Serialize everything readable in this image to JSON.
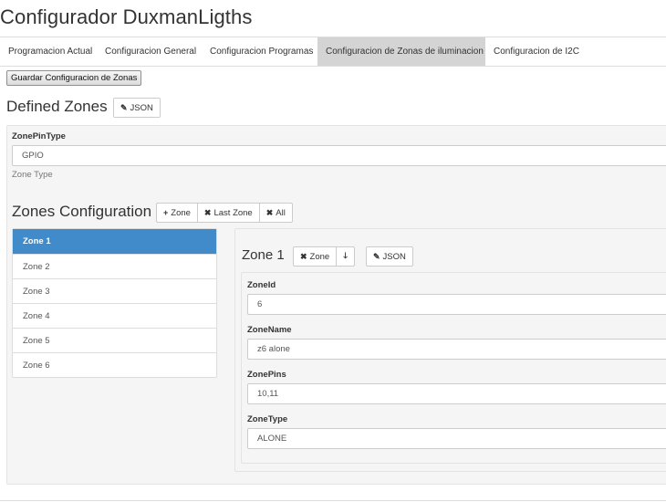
{
  "app": {
    "title": "Configurador DuxmanLigths"
  },
  "tabs": [
    {
      "label": "Programacion Actual",
      "active": false
    },
    {
      "label": "Configuracion General",
      "active": false
    },
    {
      "label": "Configuracion Programas",
      "active": false
    },
    {
      "label": "Configuracion de Zonas de iluminacion",
      "active": true
    },
    {
      "label": "Configuracion de I2C",
      "active": false
    }
  ],
  "toolbar": {
    "save_label": "Guardar Configuracion de Zonas"
  },
  "defined_zones": {
    "title": "Defined Zones",
    "json_label": "JSON",
    "pin_type": {
      "label": "ZonePinType",
      "value": "GPIO",
      "help": "Zone Type"
    }
  },
  "zones_config": {
    "title": "Zones Configuration",
    "add_zone_label": "Zone",
    "remove_last_label": "Last Zone",
    "remove_all_label": "All",
    "zones": [
      "Zone 1",
      "Zone 2",
      "Zone 3",
      "Zone 4",
      "Zone 5",
      "Zone 6"
    ],
    "selected_index": 0
  },
  "zone_detail": {
    "title": "Zone 1",
    "delete_label": "Zone",
    "json_label": "JSON",
    "fields": {
      "zone_id": {
        "label": "ZoneId",
        "value": "6"
      },
      "zone_name": {
        "label": "ZoneName",
        "value": "z6 alone"
      },
      "zone_pins": {
        "label": "ZonePins",
        "value": "10,11"
      },
      "zone_type": {
        "label": "ZoneType",
        "value": "ALONE"
      }
    }
  },
  "colors": {
    "active_item": "#428bca",
    "active_tab": "#d4d4d4",
    "well": "#f5f5f5"
  },
  "icons": {
    "edit": "pencil-icon",
    "add": "plus-icon",
    "remove": "times-icon",
    "move_down": "arrow-down-icon"
  }
}
